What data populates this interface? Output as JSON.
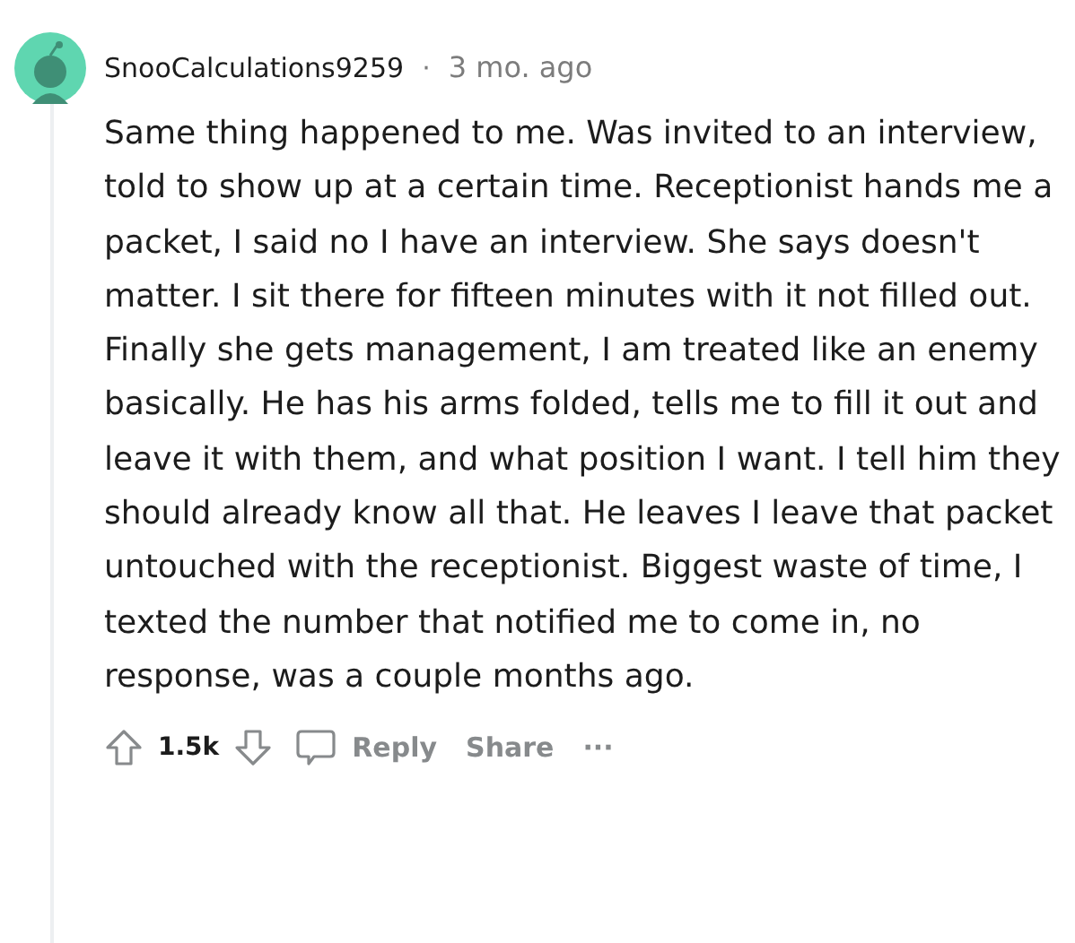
{
  "comment": {
    "author": "SnooCalculations9259",
    "separator": "·",
    "time": "3 mo. ago",
    "body": "Same thing happened to me. Was invited to an interview, told to show up at a certain time. Receptionist hands me a packet, I said no I have an interview. She says doesn't matter. I sit there for fifteen minutes with it not filled out. Finally she gets management, I am treated like an enemy basically. He has his arms folded, tells me to fill it out and leave it with them, and what position I want. I tell him they should already know all that. He leaves I leave that packet untouched with the receptionist. Biggest waste of time, I texted the number that notified me to come in, no response, was a couple months ago.",
    "score": "1.5k",
    "actions": [
      "Reply",
      "Share"
    ],
    "more": "···"
  }
}
